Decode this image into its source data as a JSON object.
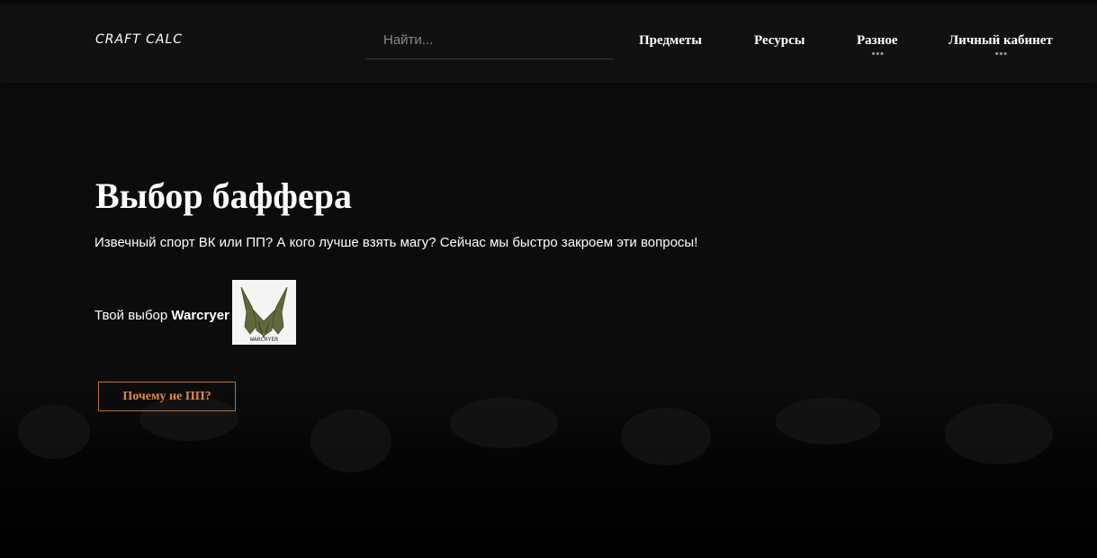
{
  "header": {
    "logo": "CRAFT CALC",
    "search": {
      "placeholder": "Найти...",
      "value": ""
    },
    "nav": [
      {
        "label": "Предметы",
        "has_dropdown": false
      },
      {
        "label": "Ресурсы",
        "has_dropdown": false
      },
      {
        "label": "Разное",
        "has_dropdown": true,
        "dots": "•••"
      },
      {
        "label": "Личный кабинет",
        "has_dropdown": true,
        "dots": "•••"
      }
    ]
  },
  "main": {
    "title": "Выбор баффера",
    "intro": "Извечный спорт ВК или ПП? А кого лучше взять магу? Сейчас мы быстро закроем эти вопросы!",
    "choice_prefix": "Твой выбор",
    "choice_value": "Warcryer",
    "class_image": {
      "caption": "WARCRYER",
      "icon": "warcryer-emblem-icon"
    },
    "button_label": "Почему не ПП?"
  },
  "colors": {
    "background": "#0c0c0c",
    "header": "#111111",
    "accent": "#e08a3c",
    "text": "#ffffff"
  }
}
